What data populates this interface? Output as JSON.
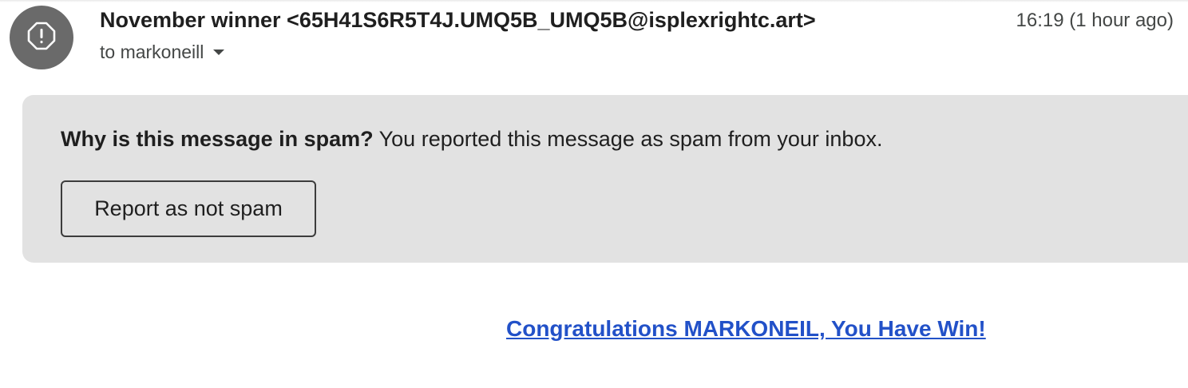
{
  "message": {
    "sender_display": "November winner <65H41S6R5T4J.UMQ5B_UMQ5B@isplexrightc.art>",
    "timestamp": "16:19 (1 hour ago)",
    "recipient": "to markoneill",
    "avatar_icon": "alert-circle-icon"
  },
  "spam_banner": {
    "question": "Why is this message in spam?",
    "explanation": "You reported this message as spam from your inbox.",
    "button_label": "Report as not spam"
  },
  "body": {
    "link_text": "Congratulations MARKONEIL, You Have Win!",
    "link_color": "#2251c8"
  }
}
